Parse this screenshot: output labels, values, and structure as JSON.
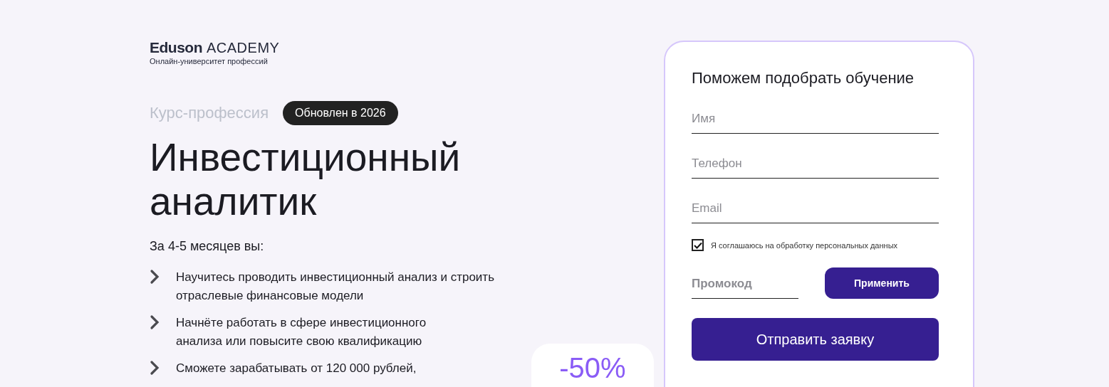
{
  "logo": {
    "brand": "Eduson",
    "suffix": "ACADEMY",
    "tagline": "Онлайн-университет профессий"
  },
  "course": {
    "type": "Курс-профессия",
    "badge": "Обновлен в 2026",
    "title": "Инвестиционный аналитик",
    "intro": "За 4-5 месяцев вы:",
    "benefits": [
      "Научитесь проводить инвестиционный анализ и строить отраслевые финансовые модели",
      "Начнёте работать в сфере инвестиционного анализа или повысите свою квалификацию",
      "Сможете зарабатывать от 120 000 рублей,"
    ],
    "discount": "-50%"
  },
  "form": {
    "title": "Поможем подобрать обучение",
    "fields": [
      {
        "placeholder": "Имя"
      },
      {
        "placeholder": "Телефон"
      },
      {
        "placeholder": "Email"
      }
    ],
    "consent": {
      "label": "Я соглашаюсь на обработку персональных данных",
      "checked": true
    },
    "promo": {
      "placeholder": "Промокод",
      "button": "Применить"
    },
    "submit": "Отправить заявку"
  }
}
